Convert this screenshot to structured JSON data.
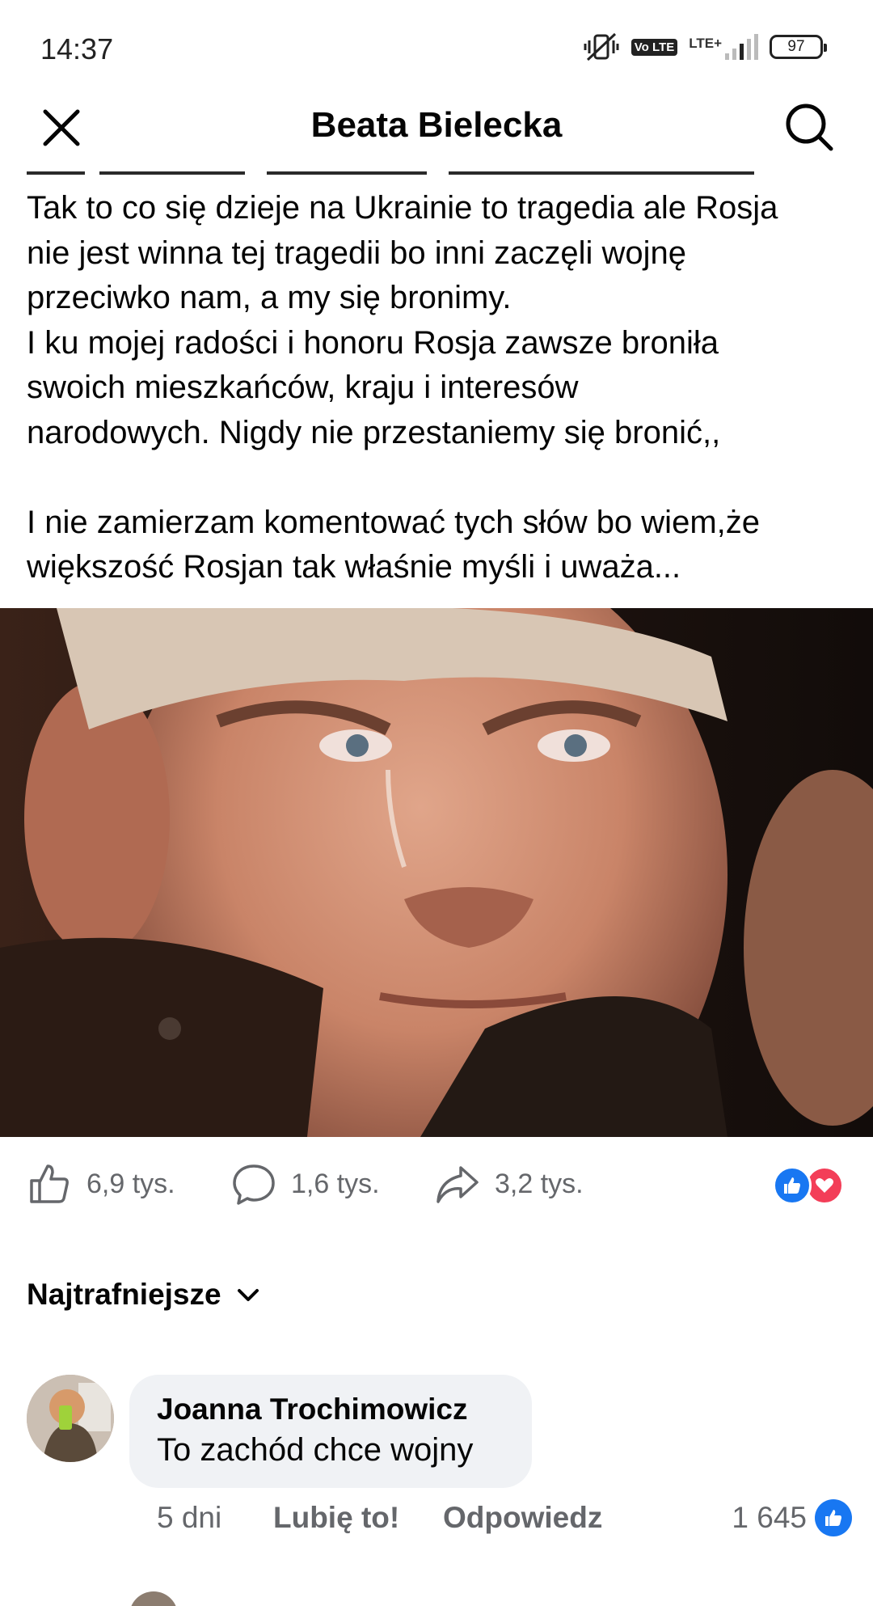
{
  "status_bar": {
    "time": "14:37",
    "network": "LTE+",
    "volte": "Vo LTE",
    "battery": "97"
  },
  "header": {
    "title": "Beata Bielecka"
  },
  "post": {
    "text": "Tak to co się dzieje na Ukrainie to tragedia ale Rosja\nnie jest winna tej tragedii bo inni zaczęli wojnę\nprzeciwko nam, a my się bronimy.\nI ku mojej radości i honoru Rosja zawsze broniła\nswoich mieszkańców, kraju i interesów\nnarodowych. Nigdy nie przestaniemy się bronić,,\n\nI nie zamierzam komentować tych słów bo wiem,że\nwiększość Rosjan tak właśnie myśli i uważa..."
  },
  "actions": {
    "likes": "6,9 tys.",
    "comments": "1,6 tys.",
    "shares": "3,2 tys."
  },
  "sort": {
    "label": "Najtrafniejsze"
  },
  "comment": {
    "author": "Joanna Trochimowicz",
    "text": "To zachód chce wojny",
    "time": "5 dni",
    "like_label": "Lubię to!",
    "reply_label": "Odpowiedz",
    "like_count": "1 645"
  },
  "colors": {
    "facebook_blue": "#1877f2",
    "love_red": "#f33e58",
    "secondary_text": "#65676b",
    "bubble_bg": "#f0f2f5"
  }
}
